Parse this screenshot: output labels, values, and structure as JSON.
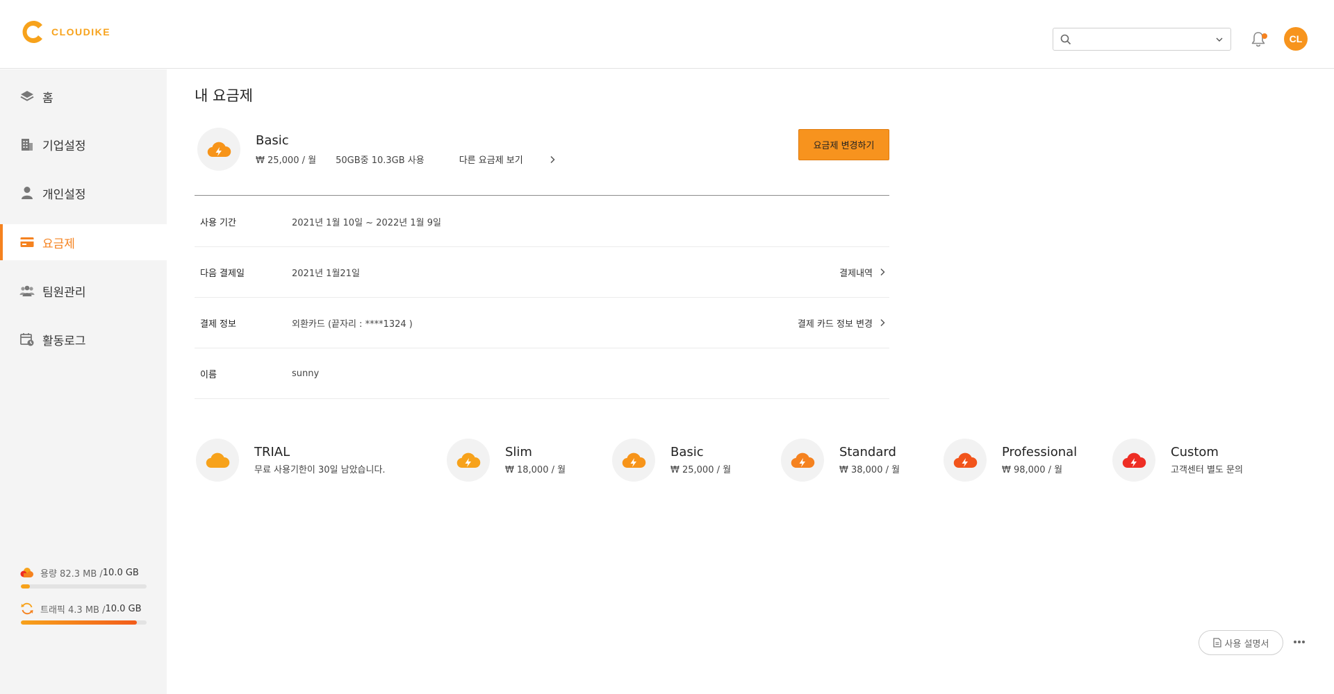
{
  "header": {
    "logo_text": "CLOUDIKE",
    "search": {
      "value": "",
      "placeholder": ""
    },
    "avatar_initials": "CL",
    "accent_color": "#f7941d"
  },
  "sidebar": {
    "items": [
      {
        "label": "홈",
        "icon": "layers-icon",
        "active": false
      },
      {
        "label": "기업설정",
        "icon": "building-icon",
        "active": false
      },
      {
        "label": "개인설정",
        "icon": "person-icon",
        "active": false
      },
      {
        "label": "요금제",
        "icon": "credit-card-icon",
        "active": true
      },
      {
        "label": "팀원관리",
        "icon": "team-icon",
        "active": false
      },
      {
        "label": "활동로그",
        "icon": "calendar-clock-icon",
        "active": false
      }
    ],
    "storage": {
      "prefix": "용량 82.3 MB / ",
      "total": "10.0 GB",
      "fill_percent": 7
    },
    "traffic": {
      "prefix": "트래픽 4.3 MB / ",
      "total": "10.0 GB",
      "fill_percent": 92
    }
  },
  "main": {
    "title": "내 요금제",
    "current_plan": {
      "name": "Basic",
      "price": "₩ 25,000 / 월",
      "usage": "50GB중 10.3GB 사용",
      "other_plans_link": "다른 요금제 보기",
      "change_button": "요금제 변경하기"
    },
    "info_rows": [
      {
        "label": "사용 기간",
        "value": "2021년 1월 10일 ~ 2022년 1월 9일",
        "action": ""
      },
      {
        "label": "다음 결제일",
        "value": "2021년 1월21일",
        "action": "결제내역"
      },
      {
        "label": "결제 정보",
        "value": "외환카드 (끝자리 : ****1324 )",
        "action": "결제 카드 정보 변경"
      },
      {
        "label": "이름",
        "value": "sunny",
        "action": ""
      }
    ],
    "plans": [
      {
        "name": "TRIAL",
        "price": "무료 사용기한이 30일 남았습니다.",
        "color": "#f7a21b",
        "bolt": false
      },
      {
        "name": "Slim",
        "price": "₩ 18,000 / 월",
        "color": "#f7a21b",
        "bolt": true
      },
      {
        "name": "Basic",
        "price": "₩ 25,000 / 월",
        "color": "#f79419",
        "bolt": true
      },
      {
        "name": "Standard",
        "price": "₩ 38,000 / 월",
        "color": "#f5821f",
        "bolt": true
      },
      {
        "name": "Professional",
        "price": "₩ 98,000 / 월",
        "color": "#f2541b",
        "bolt": true
      },
      {
        "name": "Custom",
        "price": "고객센터 별도 문의",
        "color": "#ee2e24",
        "bolt": true
      }
    ]
  },
  "footer": {
    "manual_button": "사용 설명서"
  }
}
